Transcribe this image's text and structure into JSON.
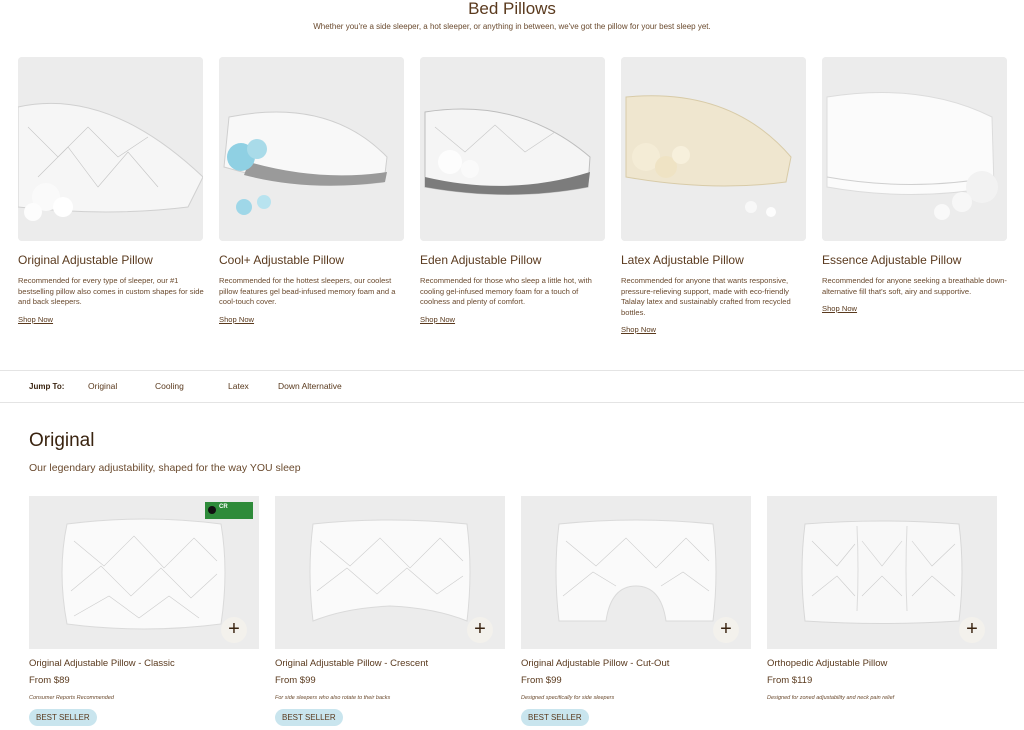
{
  "hero": {
    "title": "Bed Pillows",
    "subtitle": "Whether you're a side sleeper, a hot sleeper, or anything in between, we've got the pillow for your best sleep yet."
  },
  "categories": [
    {
      "name": "Original Adjustable Pillow",
      "desc": "Recommended for every type of sleeper, our #1 bestselling pillow also comes in custom shapes for side and back sleepers.",
      "link": "Shop Now"
    },
    {
      "name": "Cool+ Adjustable Pillow",
      "desc": "Recommended for the hottest sleepers, our coolest pillow features gel bead-infused memory foam and a cool-touch cover.",
      "link": "Shop Now"
    },
    {
      "name": "Eden Adjustable Pillow",
      "desc": "Recommended for those who sleep a little hot, with cooling gel-infused memory foam for a touch of coolness and plenty of comfort.",
      "link": "Shop Now"
    },
    {
      "name": "Latex Adjustable Pillow",
      "desc": "Recommended for anyone that wants responsive, pressure-relieving support, made with eco-friendly Talalay latex and sustainably crafted from recycled bottles.",
      "link": "Shop Now"
    },
    {
      "name": "Essence Adjustable Pillow",
      "desc": "Recommended for anyone seeking a breathable down-alternative fill that's soft, airy and supportive.",
      "link": "Shop Now"
    }
  ],
  "jump": {
    "label": "Jump To:",
    "links": [
      "Original",
      "Cooling",
      "Latex",
      "Down Alternative"
    ]
  },
  "section": {
    "title": "Original",
    "subtitle": "Our legendary adjustability, shaped for the way YOU sleep"
  },
  "products": [
    {
      "name": "Original Adjustable Pillow - Classic",
      "price": "From $89",
      "note": "Consumer Reports Recommended",
      "badge": "BEST SELLER",
      "cr": "CR"
    },
    {
      "name": "Original Adjustable Pillow - Crescent",
      "price": "From $99",
      "note": "For side sleepers who also rotate to their backs",
      "badge": "BEST SELLER"
    },
    {
      "name": "Original Adjustable Pillow - Cut-Out",
      "price": "From $99",
      "note": "Designed specifically for side sleepers",
      "badge": "BEST SELLER"
    },
    {
      "name": "Orthopedic Adjustable Pillow",
      "price": "From $119",
      "note": "Designed for zoned adjustability and neck pain relief"
    }
  ],
  "icons": {
    "add": "+",
    "cr_check": "check-icon"
  },
  "colors": {
    "text": "#5a3a1e",
    "badge_bg": "#c9e5ee",
    "cr_green": "#2e8b3a",
    "image_bg": "#ececec"
  }
}
